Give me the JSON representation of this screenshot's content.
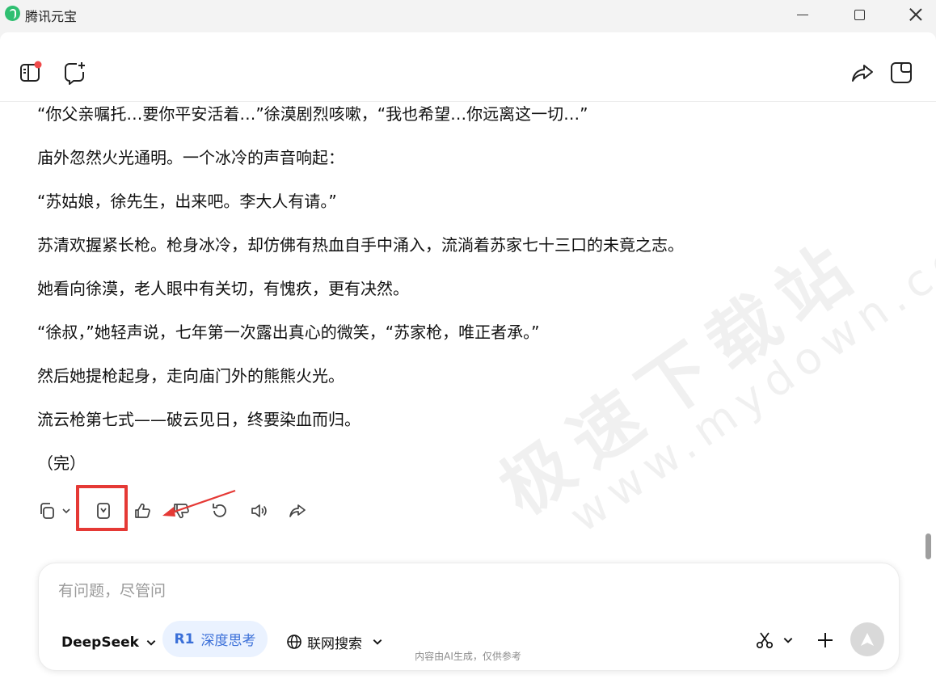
{
  "window": {
    "title": "腾讯元宝"
  },
  "chat": {
    "paragraphs": [
      "“你父亲嘱托…要你平安活着…”徐漠剧烈咳嗽，“我也希望…你远离这一切…”",
      "庙外忽然火光通明。一个冰冷的声音响起：",
      "“苏姑娘，徐先生，出来吧。李大人有请。”",
      "苏清欢握紧长枪。枪身冰冷，却仿佛有热血自手中涌入，流淌着苏家七十三口的未竟之志。",
      "她看向徐漠，老人眼中有关切，有愧疚，更有决然。",
      "“徐叔，”她轻声说，七年第一次露出真心的微笑，“苏家枪，唯正者承。”",
      "然后她提枪起身，走向庙门外的熊熊火光。",
      "流云枪第七式——破云见日，终要染血而归。",
      "（完）"
    ]
  },
  "watermark": {
    "cn": "极速下载站",
    "url": "www.mydown.com"
  },
  "input": {
    "placeholder": "有问题，尽管问",
    "value": "",
    "model": "DeepSeek",
    "deep_think_prefix": "R1",
    "deep_think_label": "深度思考",
    "web_search_label": "联网搜索"
  },
  "footer": {
    "note": "内容由AI生成，仅供参考"
  },
  "colors": {
    "accent": "#3a6fd8",
    "highlight": "#e53935",
    "badge": "#f04a4a"
  }
}
